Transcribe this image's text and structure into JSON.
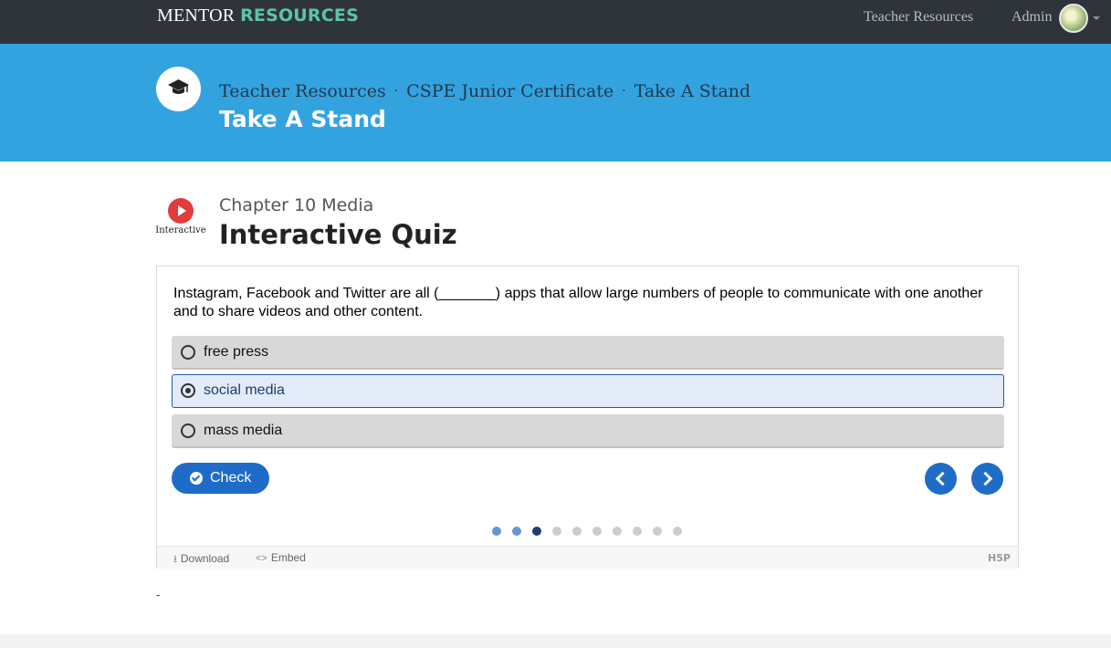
{
  "navbar": {
    "brand_part1": "MENTOR",
    "brand_part2": "RESOURCES",
    "teacher_resources": "Teacher Resources",
    "admin": "Admin"
  },
  "header": {
    "icon": "graduation-cap-icon",
    "breadcrumbs": [
      "Teacher Resources",
      "CSPE Junior Certificate",
      "Take A Stand"
    ],
    "separator": "·",
    "title": "Take A Stand"
  },
  "section": {
    "badge_label": "Interactive",
    "chapter": "Chapter 10 Media",
    "title": "Interactive Quiz"
  },
  "quiz": {
    "question": "Instagram, Facebook and Twitter are all (_______) apps that allow large numbers of people to communicate with one another and to share videos and other content.",
    "options": [
      {
        "label": "free press",
        "selected": false
      },
      {
        "label": "social media",
        "selected": true
      },
      {
        "label": "mass media",
        "selected": false
      }
    ],
    "check_label": "Check",
    "progress": {
      "total": 10,
      "current_index": 2,
      "answered": 2
    }
  },
  "footer": {
    "download": "Download",
    "embed": "Embed",
    "embed_icon": "<>",
    "logo": "H5P"
  },
  "misc": {
    "dash": "-"
  },
  "colors": {
    "navbar_bg": "#2f343a",
    "brand_accent": "#5ec4a6",
    "band_bg": "#33a3e0",
    "primary_button": "#1e6cc8",
    "play_red": "#e23b3b"
  }
}
